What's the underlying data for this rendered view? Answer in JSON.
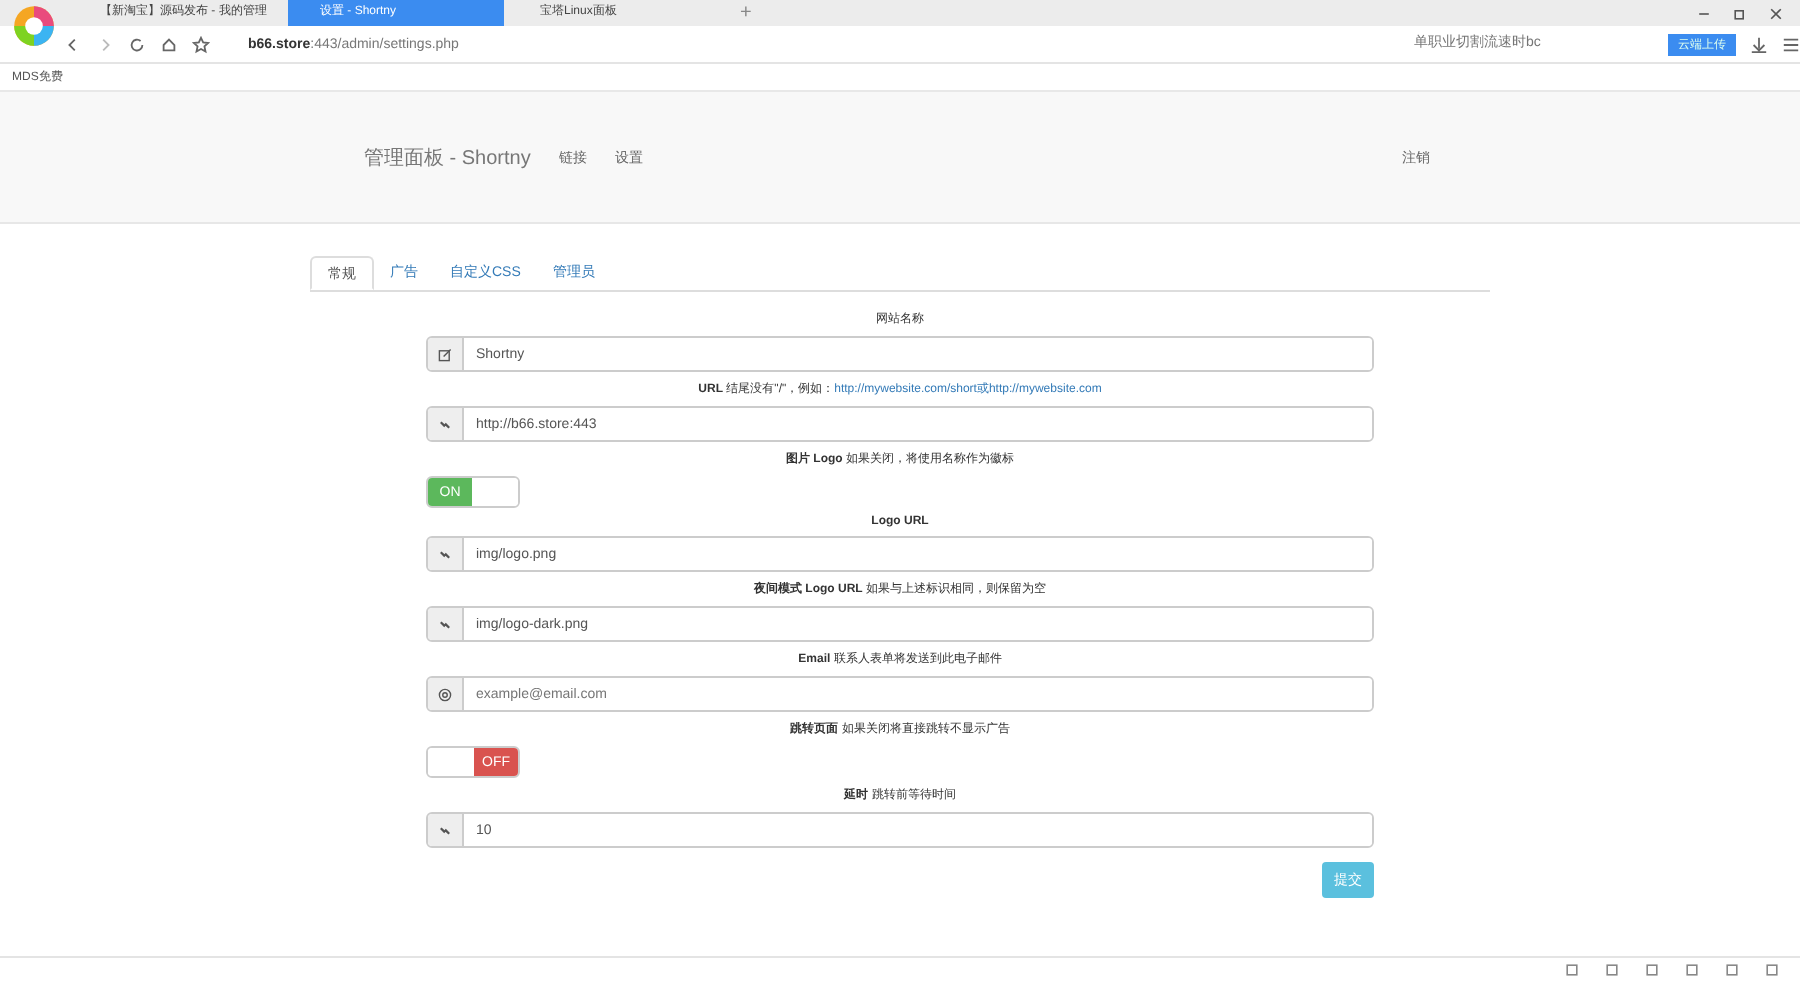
{
  "browser": {
    "tabs": [
      {
        "label": "【新淘宝】源码发布 - 我的管理",
        "selected": false
      },
      {
        "label": "设置 - Shortny",
        "selected": true
      },
      {
        "label": "宝塔Linux面板",
        "selected": false
      }
    ],
    "new_tab": "+",
    "address": {
      "host": "b66.store",
      "path": ":443/admin/settings.php"
    },
    "search": {
      "placeholder": "单职业切割流速时bc"
    },
    "upload_badge": "云端上传",
    "bookmarks": [
      {
        "label": "MDS免费"
      }
    ]
  },
  "navbar": {
    "brand": "管理面板 - Shortny",
    "links": [
      "链接",
      "设置"
    ],
    "logout": "注销"
  },
  "tabs": [
    {
      "label": "常规",
      "selected": true
    },
    {
      "label": "广告",
      "selected": false
    },
    {
      "label": "自定义CSS",
      "selected": false
    },
    {
      "label": "管理员",
      "selected": false
    }
  ],
  "fields": [
    {
      "kind": "text",
      "label": "网站名称",
      "value": "Shortny"
    },
    {
      "kind": "url",
      "label": "**URL** 结尾没有\"/\"，例如：",
      "link": "http://mywebsite.com/short或http://mywebsite.com",
      "value": "http://b66.store:443"
    },
    {
      "kind": "toggle",
      "label": "**图片 Logo** 如果关闭，将使用名称作为徽标",
      "on": true,
      "on_text": "ON"
    },
    {
      "kind": "url",
      "label": "**Logo URL**",
      "value": "img/logo.png"
    },
    {
      "kind": "url",
      "label": "**夜间模式 Logo URL** 如果与上述标识相同，则保留为空",
      "value": "img/logo-dark.png"
    },
    {
      "kind": "email",
      "label": "**Email** 联系人表单将发送到此电子邮件",
      "placeholder": "example@email.com"
    },
    {
      "kind": "toggle",
      "label": "**跳转页面** 如果关闭将直接跳转不显示广告",
      "on": false,
      "off_text": "OFF"
    },
    {
      "kind": "url",
      "label": "**延时** 跳转前等待时间",
      "value": "10"
    }
  ],
  "submit": "提交"
}
